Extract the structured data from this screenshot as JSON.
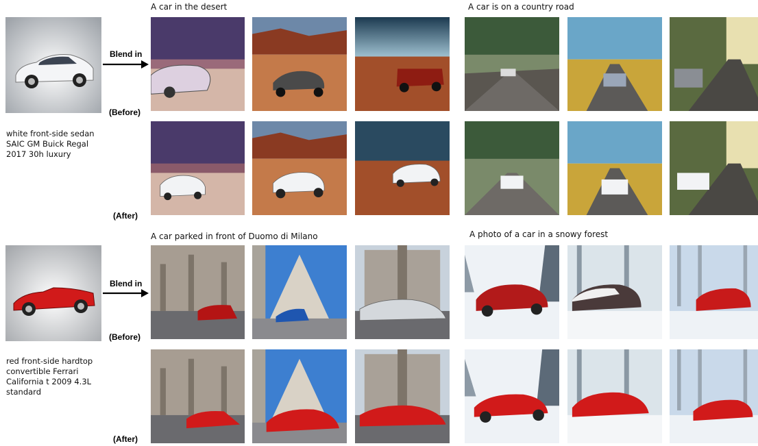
{
  "panels": [
    {
      "description": [
        "white front-side sedan",
        "SAIC GM Buick Regal",
        "2017 30h luxury"
      ],
      "blend_label": "Blend in",
      "before_label": "(Before)",
      "after_label": "(After)",
      "scenes": [
        {
          "title": "A car in the desert"
        },
        {
          "title": "A car is on a country road"
        }
      ]
    },
    {
      "description": [
        "red front-side hardtop",
        "convertible Ferrari",
        "California t 2009 4.3L",
        "standard"
      ],
      "blend_label": "Blend in",
      "before_label": "(Before)",
      "after_label": "(After)",
      "scenes": [
        {
          "title": "A car parked in front of Duomo di Milano"
        },
        {
          "title": "A photo of a car in a snowy forest"
        }
      ]
    }
  ],
  "colors": {
    "white_car": "#f2f3f5",
    "red_car": "#d11a1a",
    "desert_sky": "#4a3a6a",
    "desert_sand": "#c47a4a",
    "road_sky": "#6aa6c8",
    "grass": "#c9a53a",
    "snow": "#eef2f6",
    "stone": "#b9b0a5"
  }
}
